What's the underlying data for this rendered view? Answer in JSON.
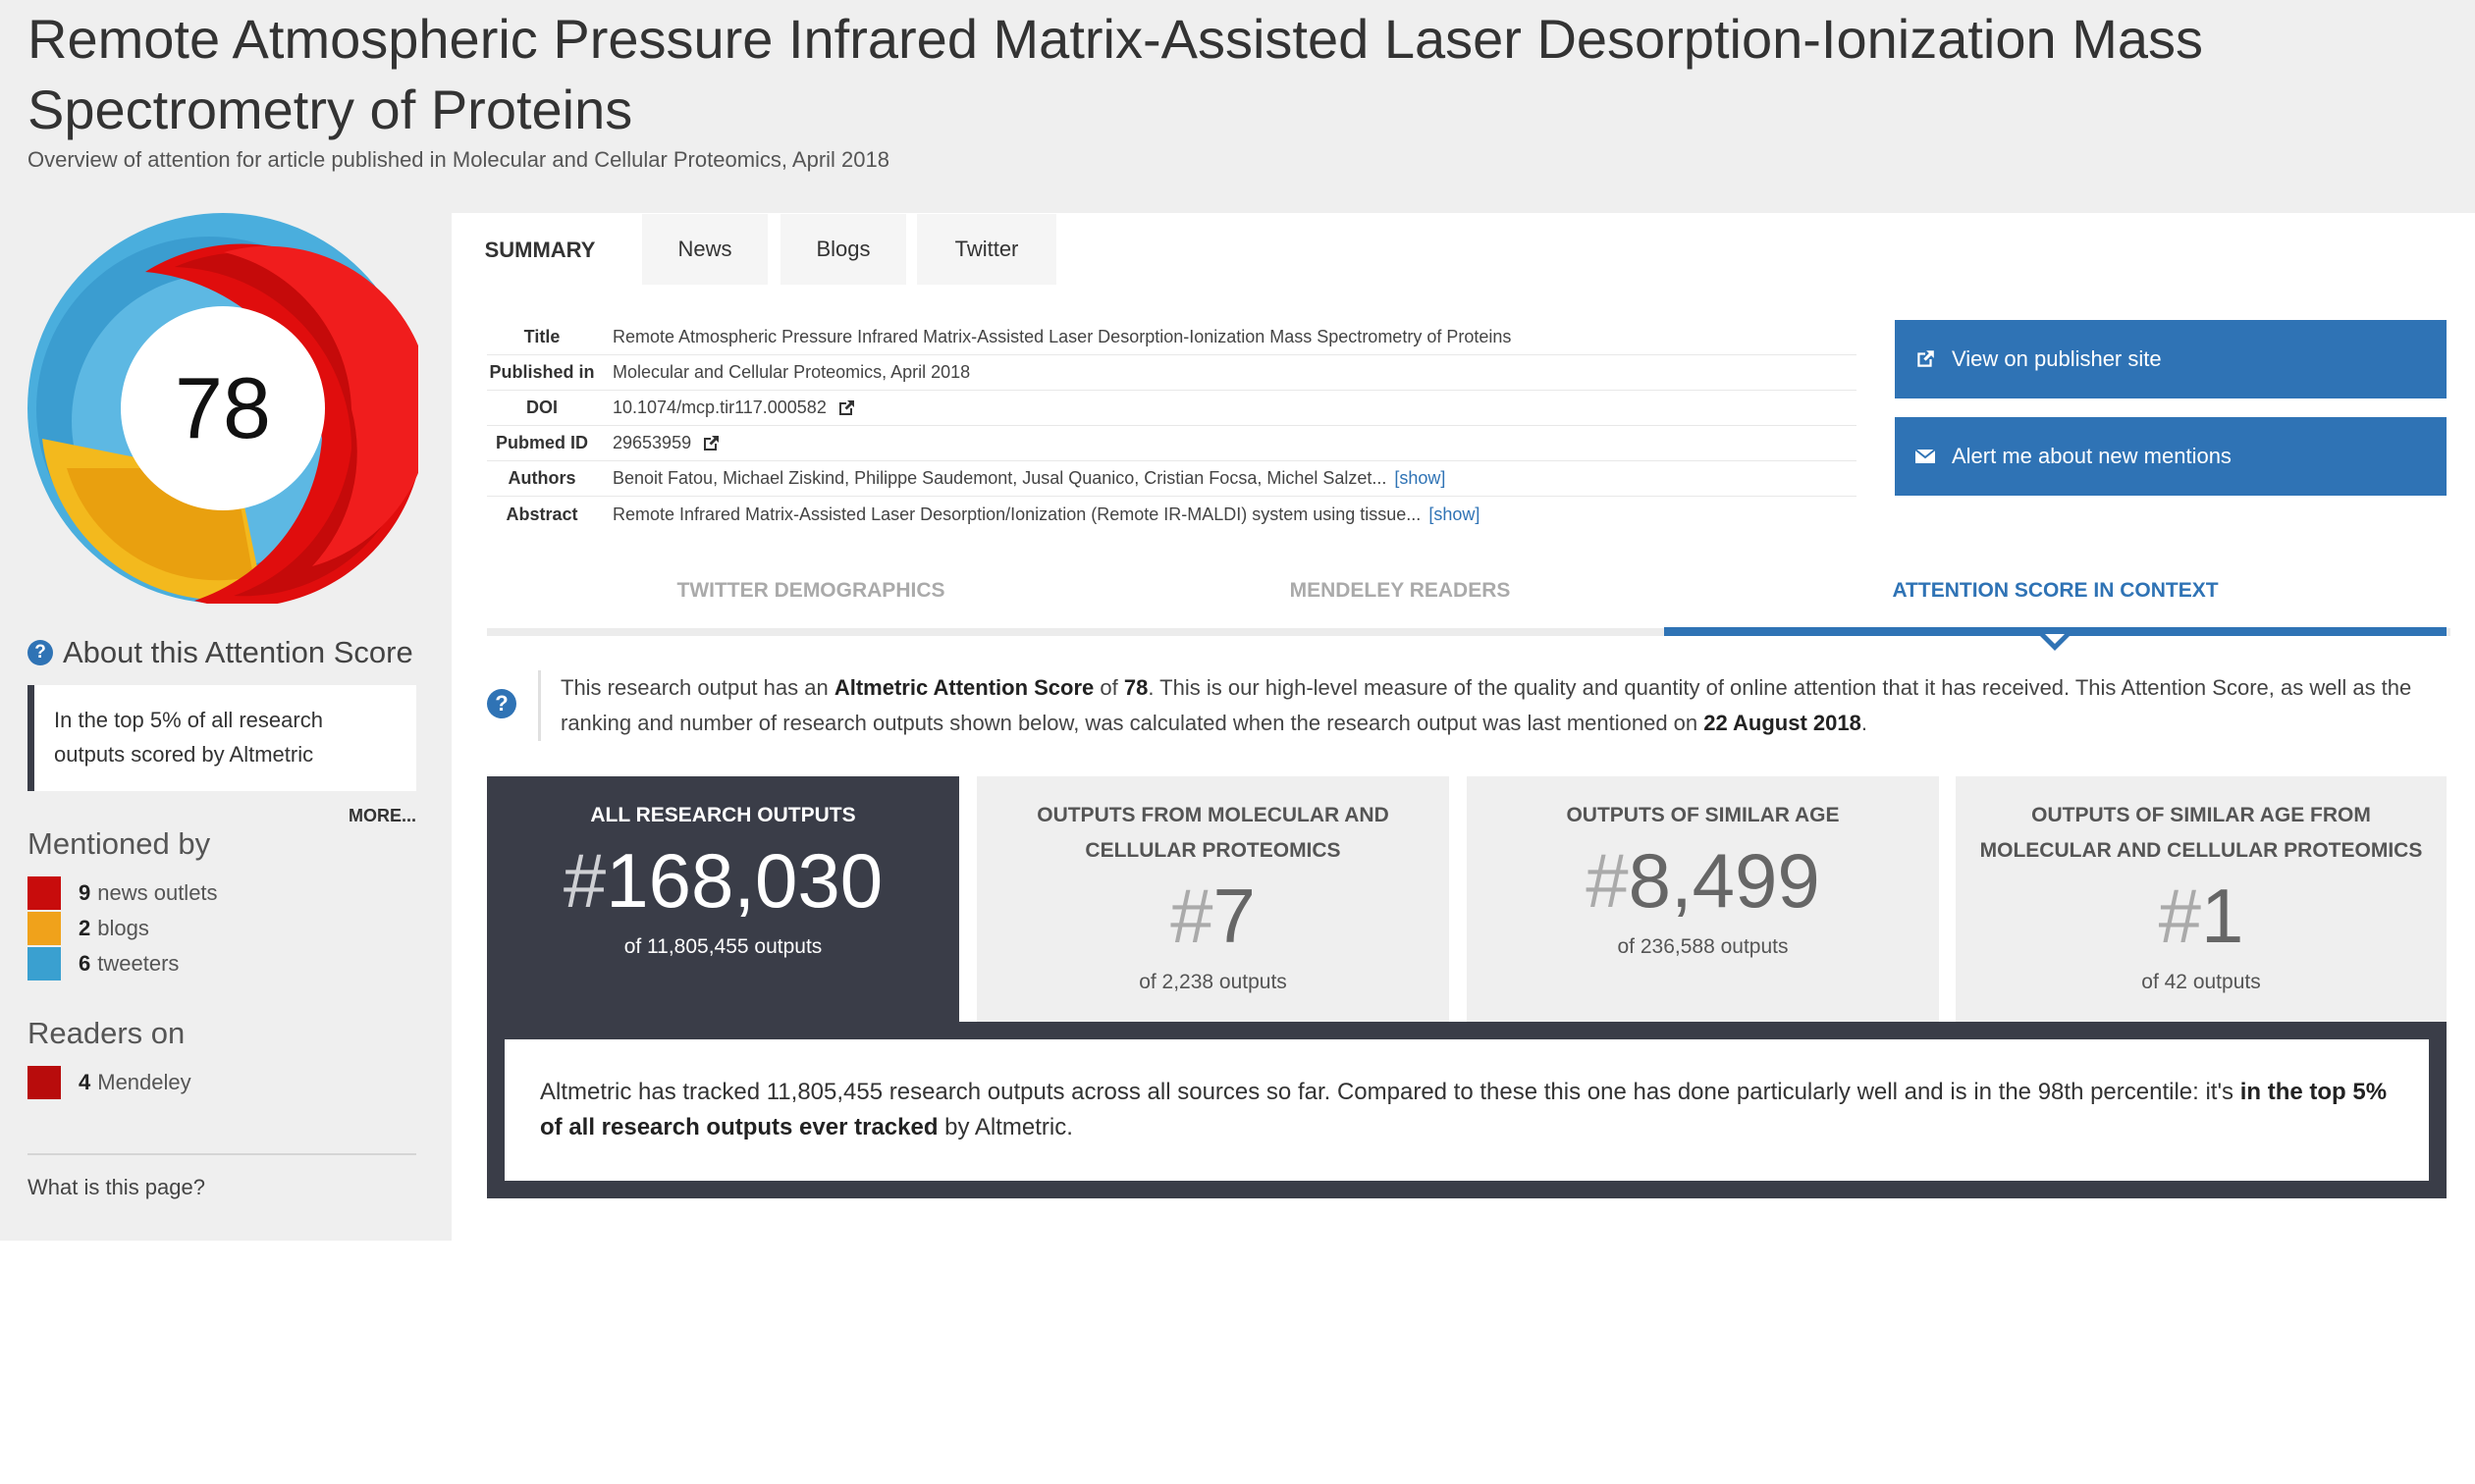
{
  "header": {
    "title": "Remote Atmospheric Pressure Infrared Matrix-Assisted Laser Desorption-Ionization Mass Spectrometry of Proteins",
    "subtitle": "Overview of attention for article published in Molecular and Cellular Proteomics, April 2018"
  },
  "score": {
    "value": "78",
    "colors": {
      "news": "#e00d0d",
      "blogs": "#f3b91d",
      "twitter": "#4aaedd"
    }
  },
  "about": {
    "heading": "About this Attention Score",
    "text": "In the top 5% of all research outputs scored by Altmetric",
    "more": "MORE..."
  },
  "mentioned_by": {
    "heading": "Mentioned by",
    "items": [
      {
        "count": "9",
        "label": "news outlets",
        "color": "#c80c0c"
      },
      {
        "count": "2",
        "label": "blogs",
        "color": "#f0a21b"
      },
      {
        "count": "6",
        "label": "tweeters",
        "color": "#3aa0d0"
      }
    ]
  },
  "readers_on": {
    "heading": "Readers on",
    "items": [
      {
        "count": "4",
        "label": "Mendeley",
        "color": "#b80c0c"
      }
    ]
  },
  "what_is": "What is this page?",
  "tabs": [
    "SUMMARY",
    "News",
    "Blogs",
    "Twitter"
  ],
  "details": {
    "title": {
      "label": "Title",
      "value": "Remote Atmospheric Pressure Infrared Matrix-Assisted Laser Desorption-Ionization Mass Spectrometry of Proteins"
    },
    "published": {
      "label": "Published in",
      "value": "Molecular and Cellular Proteomics, April 2018"
    },
    "doi": {
      "label": "DOI",
      "value": "10.1074/mcp.tir117.000582"
    },
    "pubmed": {
      "label": "Pubmed ID",
      "value": "29653959"
    },
    "authors": {
      "label": "Authors",
      "value": "Benoit Fatou, Michael Ziskind, Philippe Saudemont, Jusal Quanico, Cristian Focsa, Michel Salzet...",
      "show": "[show]"
    },
    "abstract": {
      "label": "Abstract",
      "value": "Remote Infrared Matrix-Assisted Laser Desorption/Ionization (Remote IR-MALDI) system using tissue...",
      "show": "[show]"
    }
  },
  "actions": {
    "publisher": "View on publisher site",
    "alert": "Alert me about new mentions"
  },
  "subtabs": [
    "TWITTER DEMOGRAPHICS",
    "MENDELEY READERS",
    "ATTENTION SCORE IN CONTEXT"
  ],
  "context": {
    "p1": "This research output has an ",
    "b1": "Altmetric Attention Score",
    "p2": " of ",
    "b2": "78",
    "p3": ". This is our high-level measure of the quality and quantity of online attention that it has received. This Attention Score, as well as the ranking and number of research outputs shown below, was calculated when the research output was last mentioned on ",
    "b3": "22 August 2018",
    "p4": "."
  },
  "ranks": [
    {
      "title": "ALL RESEARCH OUTPUTS",
      "hash": "#",
      "rank": "168,030",
      "of": "of 11,805,455 outputs"
    },
    {
      "title": "OUTPUTS FROM MOLECULAR AND CELLULAR PROTEOMICS",
      "hash": "#",
      "rank": "7",
      "of": "of 2,238 outputs"
    },
    {
      "title": "OUTPUTS OF SIMILAR AGE",
      "hash": "#",
      "rank": "8,499",
      "of": "of 236,588 outputs"
    },
    {
      "title": "OUTPUTS OF SIMILAR AGE FROM MOLECULAR AND CELLULAR PROTEOMICS",
      "hash": "#",
      "rank": "1",
      "of": "of 42 outputs"
    }
  ],
  "summary": {
    "p1": "Altmetric has tracked 11,805,455 research outputs across all sources so far. Compared to these this one has done particularly well and is in the 98th percentile: it's ",
    "b1": "in the top 5% of all research outputs ever tracked",
    "p2": " by Altmetric."
  }
}
